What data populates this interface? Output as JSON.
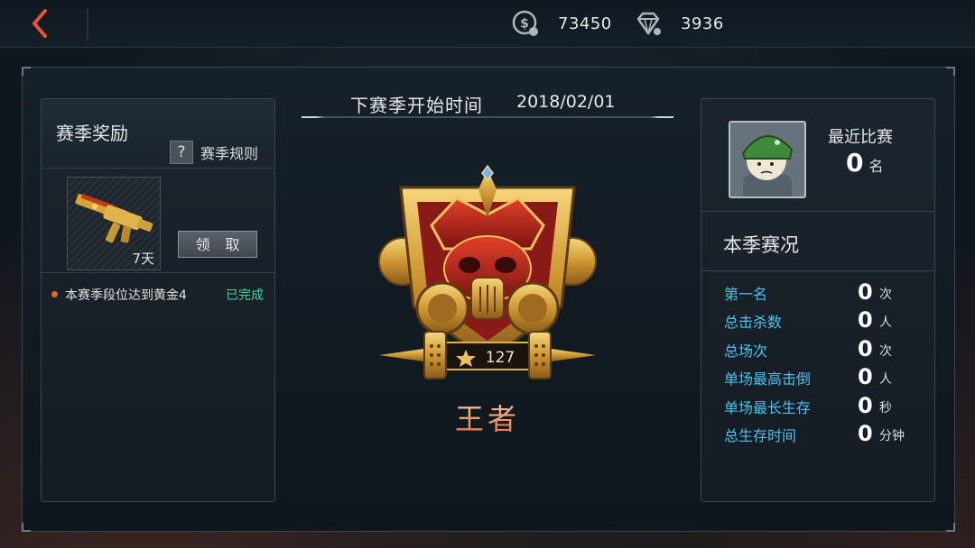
{
  "topbar": {
    "back_icon": "chevron-left-icon",
    "coins": {
      "icon": "coin-icon",
      "value": "73450"
    },
    "diamonds": {
      "icon": "diamond-icon",
      "value": "3936"
    }
  },
  "left_panel": {
    "title": "赛季奖励",
    "rules_icon": "?",
    "rules_label": "赛季规则",
    "reward": {
      "icon": "golden-rifle-icon",
      "duration": "7天",
      "claim_label": "领 取"
    },
    "tasks": [
      {
        "text": "本赛季段位达到黄金4",
        "status": "已完成"
      }
    ]
  },
  "center": {
    "next_season_label": "下赛季开始时间",
    "next_season_date": "2018/02/01",
    "emblem_icon": "king-rank-emblem-icon",
    "rank_stars": "127",
    "rank_name": "王者"
  },
  "right_panel": {
    "avatar_icon": "soldier-avatar-icon",
    "recent_label": "最近比赛",
    "recent_rank": "0",
    "recent_rank_unit": "名",
    "season_stats_title": "本季赛况",
    "stats": [
      {
        "label": "第一名",
        "value": "0",
        "unit": "次"
      },
      {
        "label": "总击杀数",
        "value": "0",
        "unit": "人"
      },
      {
        "label": "总场次",
        "value": "0",
        "unit": "次"
      },
      {
        "label": "单场最高击倒",
        "value": "0",
        "unit": "人"
      },
      {
        "label": "单场最长生存",
        "value": "0",
        "unit": "秒"
      },
      {
        "label": "总生存时间",
        "value": "0",
        "unit": "分钟"
      }
    ]
  },
  "colors": {
    "accent_blue": "#4cc2ee",
    "complete_green": "#3fd8a0",
    "back_arrow": "#e2572e",
    "rank_name": "#f0a070",
    "gold": "#d8a43a"
  }
}
